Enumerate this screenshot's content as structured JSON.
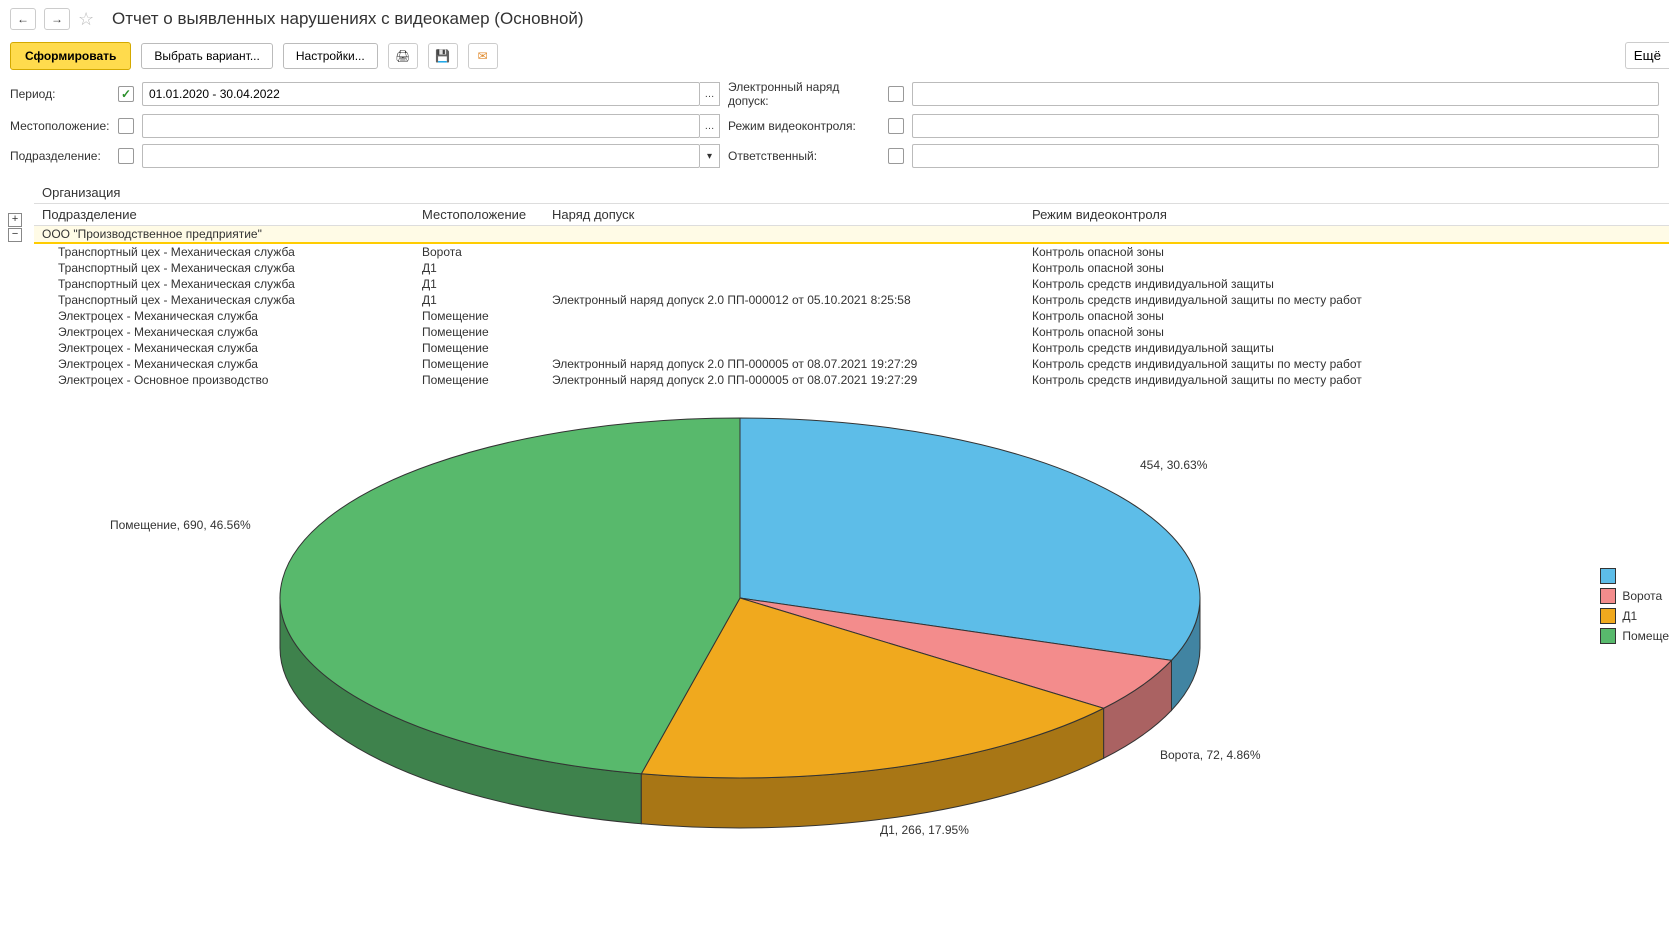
{
  "header": {
    "title": "Отчет о выявленных нарушениях с видеокамер (Основной)"
  },
  "toolbar": {
    "generate": "Сформировать",
    "choose_variant": "Выбрать вариант...",
    "settings": "Настройки...",
    "more": "Ещё"
  },
  "filters": {
    "period_label": "Период:",
    "period_value": "01.01.2020 - 30.04.2022",
    "location_label": "Местоположение:",
    "department_label": "Подразделение:",
    "ework_label": "Электронный наряд допуск:",
    "mode_label": "Режим видеоконтроля:",
    "responsible_label": "Ответственный:"
  },
  "table": {
    "org_header": "Организация",
    "col_sub": "Подразделение",
    "col_loc": "Местоположение",
    "col_nar": "Наряд допуск",
    "col_mode": "Режим видеоконтроля",
    "org_name": "ООО \"Производственное предприятие\"",
    "rows": [
      {
        "sub": "Транспортный цех - Механическая служба",
        "loc": "Ворота",
        "nar": "",
        "mode": "Контроль опасной зоны"
      },
      {
        "sub": "Транспортный цех - Механическая служба",
        "loc": "Д1",
        "nar": "",
        "mode": "Контроль опасной зоны"
      },
      {
        "sub": "Транспортный цех - Механическая служба",
        "loc": "Д1",
        "nar": "",
        "mode": "Контроль средств индивидуальной защиты"
      },
      {
        "sub": "Транспортный цех - Механическая служба",
        "loc": "Д1",
        "nar": "Электронный наряд допуск 2.0 ПП-000012 от 05.10.2021 8:25:58",
        "mode": "Контроль средств индивидуальной защиты по месту работ"
      },
      {
        "sub": "Электроцех - Механическая служба",
        "loc": "Помещение",
        "nar": "",
        "mode": "Контроль опасной зоны"
      },
      {
        "sub": "Электроцех - Механическая служба",
        "loc": "Помещение",
        "nar": "",
        "mode": "Контроль опасной зоны"
      },
      {
        "sub": "Электроцех - Механическая служба",
        "loc": "Помещение",
        "nar": "",
        "mode": "Контроль средств индивидуальной защиты"
      },
      {
        "sub": "Электроцех - Механическая служба",
        "loc": "Помещение",
        "nar": "Электронный наряд допуск 2.0 ПП-000005 от 08.07.2021 19:27:29",
        "mode": "Контроль средств индивидуальной защиты по месту работ"
      },
      {
        "sub": "Электроцех - Основное производство",
        "loc": "Помещение",
        "nar": "Электронный наряд допуск 2.0 ПП-000005 от 08.07.2021 19:27:29",
        "mode": "Контроль средств индивидуальной защиты по месту работ"
      }
    ]
  },
  "chart_data": {
    "type": "pie",
    "title": "",
    "series": [
      {
        "name": "",
        "value": 454,
        "pct": 30.63,
        "color": "#5dbde8",
        "label": "454, 30.63%"
      },
      {
        "name": "Ворота",
        "value": 72,
        "pct": 4.86,
        "color": "#f38c8c",
        "label": "Ворота, 72, 4.86%"
      },
      {
        "name": "Д1",
        "value": 266,
        "pct": 17.95,
        "color": "#f0a91e",
        "label": "Д1, 266, 17.95%"
      },
      {
        "name": "Помещение",
        "value": 690,
        "pct": 46.56,
        "color": "#58b96c",
        "label": "Помещение, 690, 46.56%"
      }
    ],
    "legend_pos": "right"
  },
  "legend": {
    "items": [
      {
        "color": "#5dbde8",
        "name": ""
      },
      {
        "color": "#f38c8c",
        "name": "Ворота"
      },
      {
        "color": "#f0a91e",
        "name": "Д1"
      },
      {
        "color": "#58b96c",
        "name": "Помещение"
      }
    ]
  }
}
